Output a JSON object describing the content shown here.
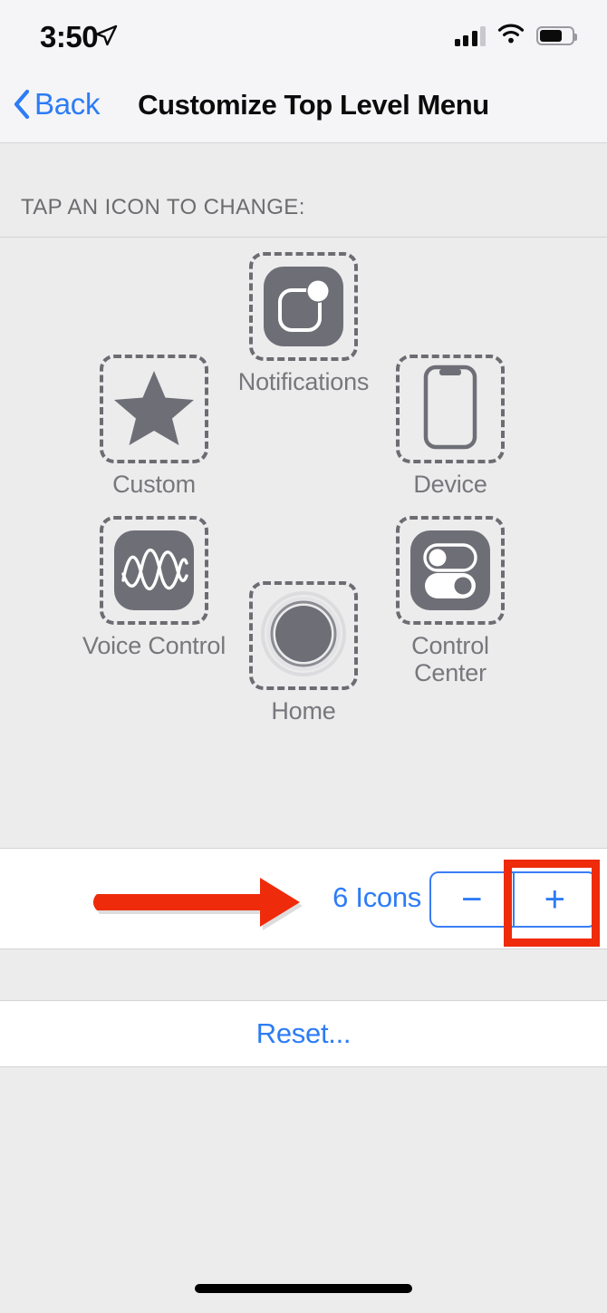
{
  "status_bar": {
    "time": "3:50",
    "location_icon": "location-arrow-icon",
    "signal_icon": "cellular-signal-icon",
    "wifi_icon": "wifi-icon",
    "battery_icon": "battery-icon",
    "battery_level_percent": 65,
    "signal_bars_active": 3,
    "signal_bars_total": 4
  },
  "nav_bar": {
    "back_label": "Back",
    "back_icon": "chevron-left-icon",
    "title": "Customize Top Level Menu",
    "tint_color": "#2d7cf6"
  },
  "section": {
    "header": "TAP AN ICON TO CHANGE:"
  },
  "icons": [
    {
      "label": "Notifications",
      "icon": "notifications-icon",
      "position": "top-center"
    },
    {
      "label": "Custom",
      "icon": "star-icon",
      "position": "middle-left"
    },
    {
      "label": "Device",
      "icon": "device-iphone-icon",
      "position": "middle-right"
    },
    {
      "label": "Voice Control",
      "icon": "voice-control-waveform-icon",
      "position": "bottom-left"
    },
    {
      "label": "Control Center",
      "icon": "control-center-toggles-icon",
      "position": "bottom-right"
    },
    {
      "label": "Home",
      "icon": "home-button-icon",
      "position": "bottom-center"
    }
  ],
  "stepper_row": {
    "count_label": "6 Icons",
    "decrement_label": "−",
    "increment_label": "+",
    "tint_color": "#2d7cf6"
  },
  "reset_row": {
    "label": "Reset..."
  },
  "annotations": {
    "arrow_color": "#ee2b0b",
    "highlight_color": "#ee2b0b",
    "arrow_points_to": "6 Icons stepper",
    "highlight_target": "increment-button"
  }
}
